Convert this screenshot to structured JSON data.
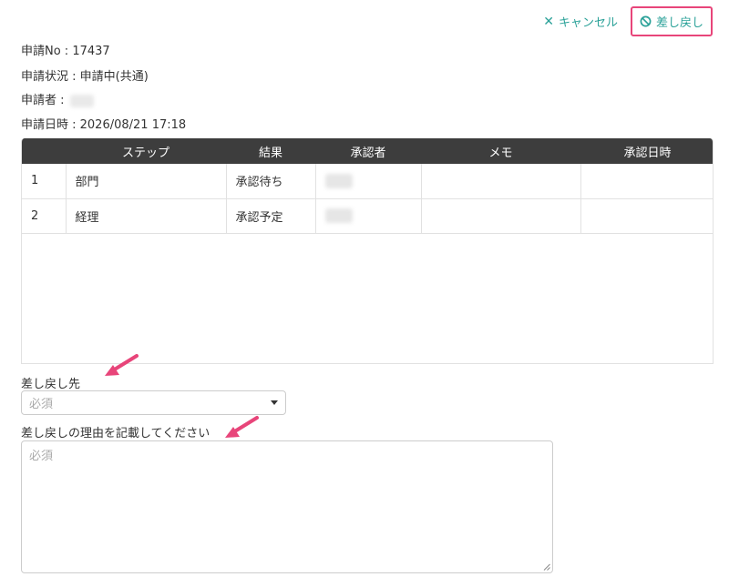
{
  "actions": {
    "cancel_label": "キャンセル",
    "return_label": "差し戻し"
  },
  "info": {
    "request_no": "申請No : 17437",
    "status": "申請状況 : 申請中(共通)",
    "applicant_label": "申請者 :",
    "datetime": "申請日時 : 2026/08/21 17:18"
  },
  "table": {
    "headers": [
      "",
      "ステップ",
      "結果",
      "承認者",
      "メモ",
      "承認日時"
    ],
    "rows": [
      {
        "no": "1",
        "step": "部門",
        "result": "承認待ち",
        "memo": "",
        "date": ""
      },
      {
        "no": "2",
        "step": "経理",
        "result": "承認予定",
        "memo": "",
        "date": ""
      }
    ]
  },
  "form": {
    "destination_label": "差し戻し先",
    "destination_placeholder": "必須",
    "reason_label": "差し戻しの理由を記載してください",
    "reason_placeholder": "必須"
  },
  "colors": {
    "accent": "#2aa198",
    "highlight": "#e8457a",
    "header_bg": "#3d3d3d"
  }
}
